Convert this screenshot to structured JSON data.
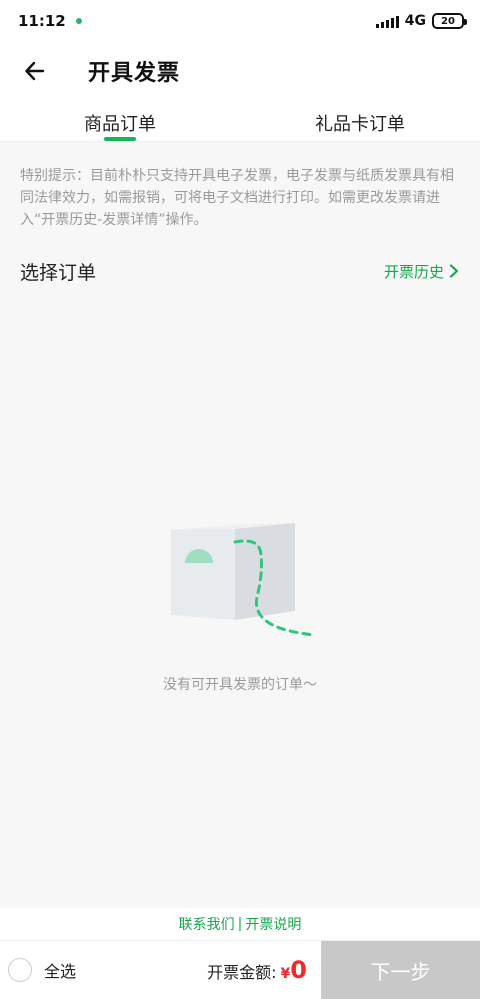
{
  "status_bar": {
    "time": "11:12",
    "network": "4G",
    "battery": "20"
  },
  "header": {
    "title": "开具发票"
  },
  "tabs": [
    {
      "label": "商品订单",
      "active": true
    },
    {
      "label": "礼品卡订单",
      "active": false
    }
  ],
  "notice": "特别提示：目前朴朴只支持开具电子发票，电子发票与纸质发票具有相同法律效力，如需报销，可将电子文档进行打印。如需更改发票请进入“开票历史-发票详情”操作。",
  "section": {
    "title": "选择订单",
    "history_link": "开票历史"
  },
  "empty_state": {
    "message": "没有可开具发票的订单～"
  },
  "help": {
    "contact": "联系我们",
    "separator": "|",
    "explain": "开票说明"
  },
  "footer": {
    "select_all": "全选",
    "amount_label": "开票金额:",
    "currency": "¥",
    "amount": "0",
    "next_button": "下一步"
  },
  "colors": {
    "accent": "#18b25a",
    "price": "#ee2b2b",
    "disabled_button": "#c8c8c8"
  }
}
